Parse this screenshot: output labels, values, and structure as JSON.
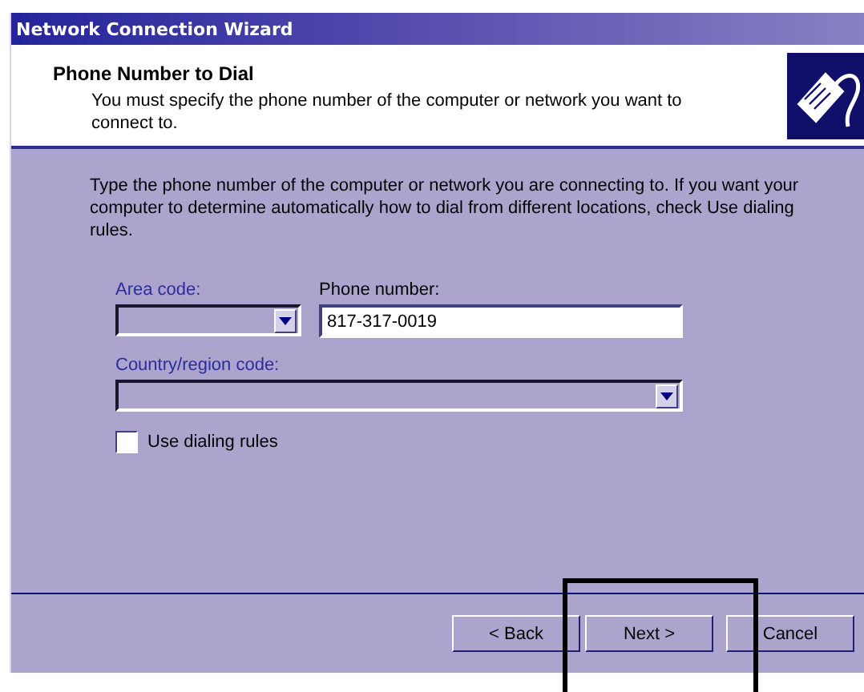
{
  "window": {
    "title": "Network Connection Wizard"
  },
  "header": {
    "title": "Phone Number to Dial",
    "subtitle": "You must specify the phone number of the computer or network you want to connect to."
  },
  "instructions": "Type the phone number of the computer or network you are connecting to. If you want your computer to determine automatically how to dial from different locations, check Use dialing rules.",
  "area_code": {
    "label": "Area code:",
    "disabled": true
  },
  "phone_number": {
    "label": "Phone number:",
    "value": "817-317-0019"
  },
  "country_code": {
    "label": "Country/region code:",
    "disabled": true
  },
  "dialing_rules": {
    "label": "Use dialing rules",
    "checked": false
  },
  "buttons": [
    {
      "label": "< Back"
    },
    {
      "label": "Next >"
    },
    {
      "label": "Cancel"
    }
  ]
}
